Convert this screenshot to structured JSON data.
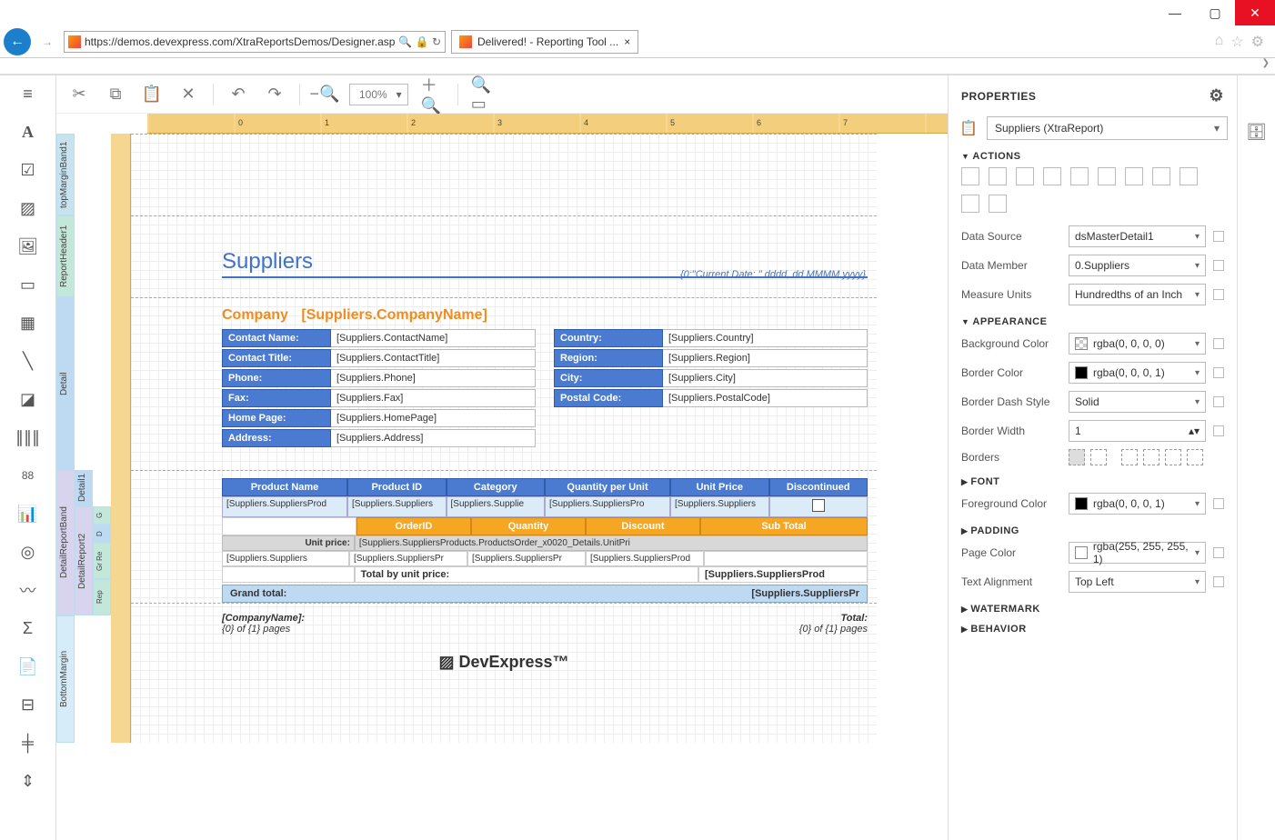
{
  "window": {
    "title": "Delivered! - Reporting Tool ..."
  },
  "browser": {
    "url": "https://demos.devexpress.com/XtraReportsDemos/Designer.asp",
    "tab_title": "Delivered! - Reporting Tool ..."
  },
  "toolbar": {
    "zoom": "100%"
  },
  "ruler_marks": [
    "0",
    "1",
    "2",
    "3",
    "4",
    "5",
    "6",
    "7"
  ],
  "bands": {
    "top_margin": "topMarginBand1",
    "report_header": "ReportHeader1",
    "detail": "Detail",
    "detail1": "Detail1",
    "detail_report_band": "DetailReportBand",
    "detail_report2": "DetailReport2",
    "group_header": "G",
    "detail_inner": "D",
    "group_footer": "Gr Re",
    "report_footer": "Rep",
    "bottom_margin": "BottomMargin"
  },
  "report": {
    "title": "Suppliers",
    "date_fmt": "{0:\"Current Date: \" dddd, dd MMMM yyyy}",
    "company_label": "Company",
    "company_value": "[Suppliers.CompanyName]",
    "fields_left": [
      {
        "label": "Contact Name:",
        "value": "[Suppliers.ContactName]"
      },
      {
        "label": "Contact Title:",
        "value": "[Suppliers.ContactTitle]"
      },
      {
        "label": "Phone:",
        "value": "[Suppliers.Phone]"
      },
      {
        "label": "Fax:",
        "value": "[Suppliers.Fax]"
      },
      {
        "label": "Home Page:",
        "value": "[Suppliers.HomePage]"
      },
      {
        "label": "Address:",
        "value": "[Suppliers.Address]"
      }
    ],
    "fields_right": [
      {
        "label": "Country:",
        "value": "[Suppliers.Country]"
      },
      {
        "label": "Region:",
        "value": "[Suppliers.Region]"
      },
      {
        "label": "City:",
        "value": "[Suppliers.City]"
      },
      {
        "label": "Postal Code:",
        "value": "[Suppliers.PostalCode]"
      }
    ],
    "product_headers": [
      "Product Name",
      "Product ID",
      "Category",
      "Quantity per Unit",
      "Unit Price",
      "Discontinued"
    ],
    "product_row": [
      "[Suppliers.SuppliersProd",
      "[Suppliers.Suppliers",
      "[Suppliers.Supplie",
      "[Suppliers.SuppliersPro",
      "[Suppliers.Suppliers",
      ""
    ],
    "order_headers": [
      "OrderID",
      "Quantity",
      "Discount",
      "Sub Total"
    ],
    "unit_price_label": "Unit price:",
    "unit_price_value": "[Suppliers.SuppliersProducts.ProductsOrder_x0020_Details.UnitPri",
    "order_row": [
      "[Suppliers.Suppliers",
      "[Suppliers.SuppliersPr",
      "[Suppliers.SuppliersPr",
      "[Suppliers.SuppliersProd"
    ],
    "total_label": "Total by unit price:",
    "total_value": "[Suppliers.SuppliersProd",
    "grand_label": "Grand total:",
    "grand_value": "[Suppliers.SuppliersPr",
    "footer_company": "[CompanyName]:",
    "footer_total": "Total:",
    "footer_pages_l": "{0} of {1} pages",
    "footer_pages_r": "{0} of {1} pages",
    "dx_logo": "DevExpress"
  },
  "properties": {
    "title": "PROPERTIES",
    "object": "Suppliers (XtraReport)",
    "sections": {
      "actions": "ACTIONS",
      "appearance": "APPEARANCE",
      "font": "FONT",
      "padding": "PADDING",
      "watermark": "WATERMARK",
      "behavior": "BEHAVIOR"
    },
    "rows": {
      "data_source": {
        "label": "Data Source",
        "value": "dsMasterDetail1"
      },
      "data_member": {
        "label": "Data Member",
        "value": "0.Suppliers"
      },
      "measure_units": {
        "label": "Measure Units",
        "value": "Hundredths of an Inch"
      },
      "background_color": {
        "label": "Background Color",
        "value": "rgba(0, 0, 0, 0)",
        "swatch": "transparent"
      },
      "border_color": {
        "label": "Border Color",
        "value": "rgba(0, 0, 0, 1)",
        "swatch": "#000"
      },
      "border_dash": {
        "label": "Border Dash Style",
        "value": "Solid"
      },
      "border_width": {
        "label": "Border Width",
        "value": "1"
      },
      "borders": {
        "label": "Borders"
      },
      "foreground_color": {
        "label": "Foreground Color",
        "value": "rgba(0, 0, 0, 1)",
        "swatch": "#000"
      },
      "page_color": {
        "label": "Page Color",
        "value": "rgba(255, 255, 255, 1)",
        "swatch": "#fff"
      },
      "text_align": {
        "label": "Text Alignment",
        "value": "Top Left"
      }
    }
  }
}
